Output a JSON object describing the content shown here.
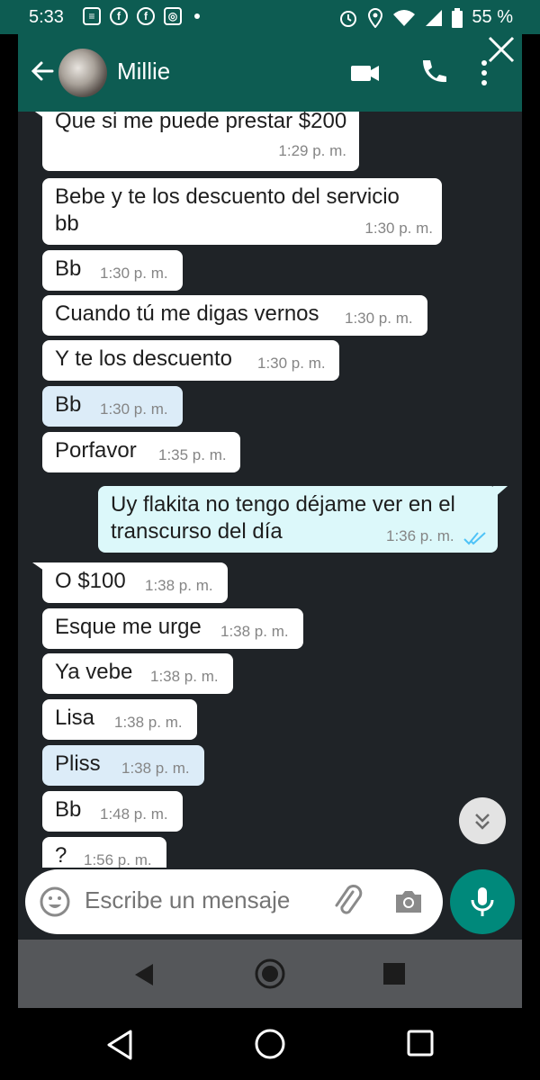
{
  "status": {
    "time": "5:33",
    "battery": "55 %"
  },
  "header": {
    "contact_name": "Millie"
  },
  "messages": [
    {
      "text": "Que si me puede prestar $200",
      "time": "1:29 p. m."
    },
    {
      "line1": "Bebe y te los descuento del servicio",
      "line2": "bb",
      "time": "1:30 p. m."
    },
    {
      "text": "Bb",
      "time": "1:30 p. m."
    },
    {
      "text": "Cuando tú me digas vernos",
      "time": "1:30 p. m."
    },
    {
      "text": "Y te los descuento",
      "time": "1:30 p. m."
    },
    {
      "text": "Bb",
      "time": "1:30 p. m."
    },
    {
      "text": "Porfavor",
      "time": "1:35 p. m."
    },
    {
      "line1": "Uy flakita no tengo déjame ver en el",
      "line2": "transcurso del día",
      "time": "1:36 p. m."
    },
    {
      "text": "O $100",
      "time": "1:38 p. m."
    },
    {
      "text": "Esque me urge",
      "time": "1:38 p. m."
    },
    {
      "text": "Ya vebe",
      "time": "1:38 p. m."
    },
    {
      "text": "Lisa",
      "time": "1:38 p. m."
    },
    {
      "text": "Pliss",
      "time": "1:38 p. m."
    },
    {
      "text": "Bb",
      "time": "1:48 p. m."
    },
    {
      "text": "?",
      "time": "1:56 p. m."
    }
  ],
  "composer": {
    "placeholder": "Escribe un mensaje"
  },
  "colors": {
    "header": "#0d5c52",
    "chat_bg": "#1f2327",
    "mic": "#00897b",
    "outgoing": "#dcf8fa",
    "ticks": "#4fc3f7"
  },
  "icons": [
    "back-arrow-icon",
    "video-call-icon",
    "phone-icon",
    "more-vert-icon",
    "close-icon",
    "double-check-icon",
    "scroll-down-icon",
    "emoji-icon",
    "attach-icon",
    "camera-icon",
    "mic-icon",
    "nav-back-icon",
    "nav-home-icon",
    "nav-recents-icon"
  ]
}
